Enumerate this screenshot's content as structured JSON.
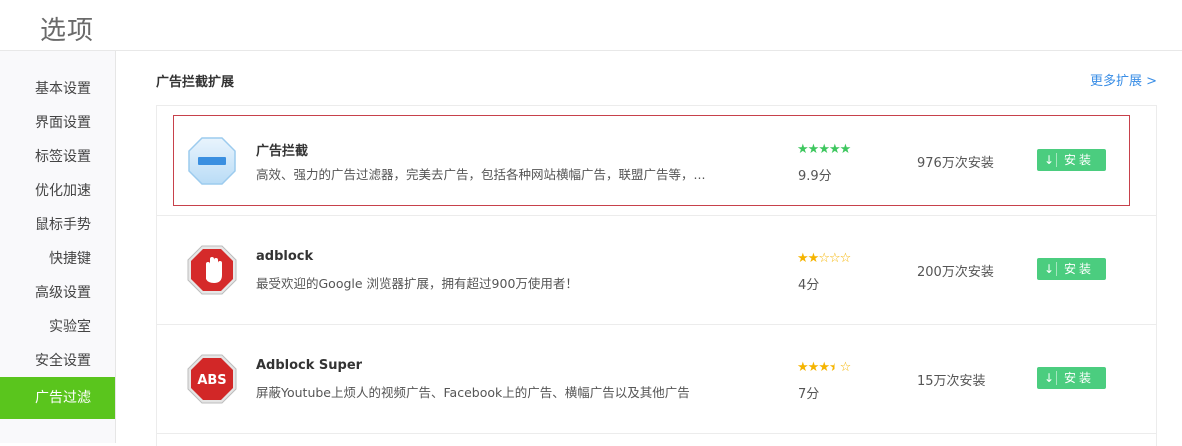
{
  "header": {
    "title": "选项"
  },
  "sidebar": {
    "items": [
      {
        "label": "基本设置",
        "active": false
      },
      {
        "label": "界面设置",
        "active": false
      },
      {
        "label": "标签设置",
        "active": false
      },
      {
        "label": "优化加速",
        "active": false
      },
      {
        "label": "鼠标手势",
        "active": false
      },
      {
        "label": "快捷键",
        "active": false
      },
      {
        "label": "高级设置",
        "active": false
      },
      {
        "label": "实验室",
        "active": false
      },
      {
        "label": "安全设置",
        "active": false
      },
      {
        "label": "广告过滤",
        "active": true
      }
    ]
  },
  "main": {
    "section_title": "广告拦截扩展",
    "more_link": "更多扩展 >",
    "extensions": [
      {
        "name": "广告拦截",
        "description": "高效、强力的广告过滤器，完美去广告，包括各种网站横幅广告，联盟广告等，...",
        "rating": 5,
        "score": "9.9分",
        "installs": "976万次安装",
        "install_label": "安装",
        "icon": "ad-blocker-octagon-icon"
      },
      {
        "name": "adblock",
        "description": "最受欢迎的Google 浏览器扩展，拥有超过900万使用者！",
        "rating": 2,
        "score": "4分",
        "installs": "200万次安装",
        "install_label": "安装",
        "icon": "stop-hand-icon"
      },
      {
        "name": "Adblock Super",
        "description": "屏蔽Youtube上烦人的视频广告、Facebook上的广告、横幅广告以及其他广告",
        "rating": 3.5,
        "score": "7分",
        "installs": "15万次安装",
        "install_label": "安装",
        "icon": "abs-stop-sign-icon"
      }
    ]
  },
  "colors": {
    "active_nav": "#5ac51d",
    "install_button": "#4bcd7f",
    "link": "#3a8ee6",
    "star_gold": "#f5b400",
    "star_green": "#3ec75f",
    "selection_border": "#c7414b"
  }
}
